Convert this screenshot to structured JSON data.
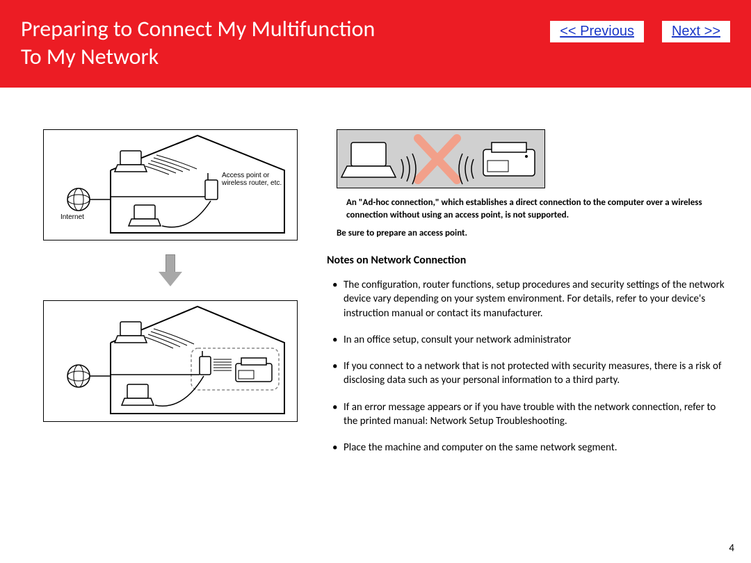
{
  "header": {
    "title_line1": "Preparing to Connect My Multifunction",
    "title_line2": "To My Network",
    "prev_label": "<< Previous",
    "next_label": "Next >>"
  },
  "left": {
    "internet_label": "Internet",
    "ap_label_line1": "Access point or",
    "ap_label_line2": "wireless router, etc."
  },
  "right": {
    "adhoc_warning": "An \"Ad-hoc connection,\" which establishes a direct connection to the computer over a wireless connection without using an access point, is not supported.",
    "prepare_text": "Be sure to prepare an access point.",
    "notes_heading": "Notes on Network Connection",
    "notes": [
      "The configuration, router functions, setup procedures and security settings of the network device vary depending on your system environment. For details, refer to your device's instruction manual or contact its manufacturer.",
      "In an office setup, consult your network administrator",
      "If you connect to a network that is not protected with security measures, there is a risk of disclosing data such as your personal information to a third party.",
      "If an error message appears or if you have trouble with the network connection, refer to the printed manual: Network Setup Troubleshooting.",
      "Place the machine and computer on the same network segment."
    ]
  },
  "page_number": "4"
}
